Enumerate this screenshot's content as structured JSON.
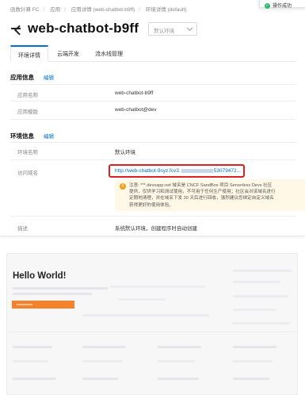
{
  "breadcrumb": [
    "函数计算 FC",
    "应用",
    "应用详情 (web-chatbot-b9ff)",
    "环境详情 (default)"
  ],
  "toast": {
    "text": "操作成功"
  },
  "header": {
    "title": "web-chatbot-b9ff",
    "env_select": "默认环境"
  },
  "tabs": [
    {
      "label": "环境详情",
      "active": true
    },
    {
      "label": "云端开发",
      "active": false
    },
    {
      "label": "流水线管理",
      "active": false
    }
  ],
  "app_info": {
    "heading": "应用信息",
    "edit_label": "编辑",
    "rows": [
      {
        "label": "应用名称",
        "value": "web-chatbot-b9ff"
      },
      {
        "label": "应用模版",
        "value": "web-chatbot@dev"
      }
    ]
  },
  "env_info": {
    "heading": "环境信息",
    "edit_label": "编辑",
    "env_name_label": "环境名称",
    "env_name_value": "默认环境",
    "url_label": "访问域名",
    "url_prefix": "http://web-chatbot-9syz.fcv3.",
    "url_suffix": "53079472...",
    "notice_lines": [
      "注意: ***.devsapp.net 域名是 CNCF SandBox 项目 Serverless Devs 社区",
      "提供，仅供学习和测试使用，不可用于任何生产使用；社区会对该域名进行",
      "定期地清理，并在域名下发 30 天后进行回收，强烈建议您绑定自定义域名",
      "获得更好的使用体验。"
    ],
    "desc_label": "描述",
    "desc_value": "系统默认环境，创建程序时自动创建"
  },
  "preview": {
    "title": "Hello World!"
  },
  "colors": {
    "accent": "#0070cc",
    "highlight_border": "#e02020",
    "notice_bg": "#fff8e6",
    "button": "#f5822a"
  }
}
